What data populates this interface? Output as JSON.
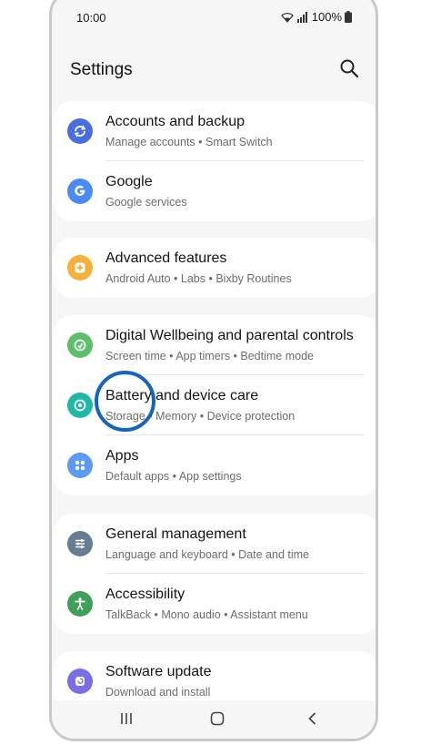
{
  "status": {
    "time": "10:00",
    "battery": "100%"
  },
  "header": {
    "title": "Settings"
  },
  "groups": [
    {
      "items": [
        {
          "title": "Accounts and backup",
          "subtitle": "Manage accounts  •  Smart Switch",
          "icon": "sync-icon",
          "color": "#4a6ee0"
        },
        {
          "title": "Google",
          "subtitle": "Google services",
          "icon": "google-g-icon",
          "color": "#4a8af4"
        }
      ]
    },
    {
      "items": [
        {
          "title": "Advanced features",
          "subtitle": "Android Auto  •  Labs  •  Bixby Routines",
          "icon": "puzzle-plus-icon",
          "color": "#f6b03b"
        }
      ]
    },
    {
      "items": [
        {
          "title": "Digital Wellbeing and parental controls",
          "subtitle": "Screen time  •  App timers  •  Bedtime mode",
          "icon": "wellbeing-icon",
          "color": "#5cbf6a"
        },
        {
          "title": "Battery and device care",
          "subtitle": "Storage  •  Memory  •  Device protection",
          "icon": "device-care-icon",
          "color": "#1fb7a5"
        },
        {
          "title": "Apps",
          "subtitle": "Default apps  •  App settings",
          "icon": "apps-grid-icon",
          "color": "#5b9bf2"
        }
      ]
    },
    {
      "items": [
        {
          "title": "General management",
          "subtitle": "Language and keyboard  •  Date and time",
          "icon": "sliders-icon",
          "color": "#677d96"
        },
        {
          "title": "Accessibility",
          "subtitle": "TalkBack  •  Mono audio  •  Assistant menu",
          "icon": "accessibility-icon",
          "color": "#3ea05a"
        }
      ]
    },
    {
      "items": [
        {
          "title": "Software update",
          "subtitle": "Download and install",
          "icon": "software-update-icon",
          "color": "#7a6de8"
        }
      ]
    }
  ],
  "navbar": {
    "buttons": [
      "recent-apps",
      "home",
      "back"
    ]
  }
}
